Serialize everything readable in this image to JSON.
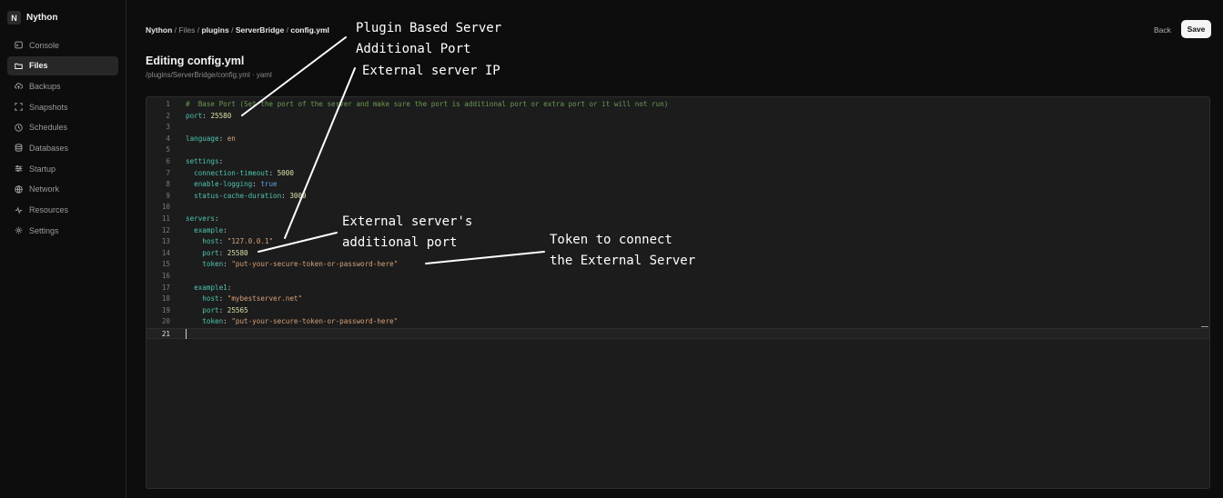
{
  "brand": {
    "initial": "N",
    "name": "Nython"
  },
  "nav": [
    {
      "label": "Console",
      "icon": "console-icon",
      "active": false
    },
    {
      "label": "Files",
      "icon": "folder-icon",
      "active": true
    },
    {
      "label": "Backups",
      "icon": "cloud-upload-icon",
      "active": false
    },
    {
      "label": "Snapshots",
      "icon": "expand-icon",
      "active": false
    },
    {
      "label": "Schedules",
      "icon": "clock-icon",
      "active": false
    },
    {
      "label": "Databases",
      "icon": "database-icon",
      "active": false
    },
    {
      "label": "Startup",
      "icon": "sliders-icon",
      "active": false
    },
    {
      "label": "Network",
      "icon": "globe-icon",
      "active": false
    },
    {
      "label": "Resources",
      "icon": "activity-icon",
      "active": false
    },
    {
      "label": "Settings",
      "icon": "gear-icon",
      "active": false
    }
  ],
  "breadcrumb": {
    "root": "Nython",
    "sep": "/",
    "parts": [
      "Files",
      "plugins",
      "ServerBridge"
    ],
    "current": "config.yml"
  },
  "header": {
    "title": "Editing config.yml",
    "path": "/plugins/ServerBridge/config.yml · yaml",
    "back_label": "Back",
    "save_label": "Save"
  },
  "editor": {
    "current_line": 21,
    "lines": [
      {
        "n": "1",
        "t": [
          [
            "c",
            "#  Base Port (Set the port of the server and make sure the port is additional port or extra port or it will not run)"
          ]
        ]
      },
      {
        "n": "2",
        "t": [
          [
            "k",
            "port"
          ],
          [
            "p",
            ": "
          ],
          [
            "n",
            "25580"
          ]
        ]
      },
      {
        "n": "3",
        "t": []
      },
      {
        "n": "4",
        "t": [
          [
            "k",
            "language"
          ],
          [
            "p",
            ": "
          ],
          [
            "s",
            "en"
          ]
        ]
      },
      {
        "n": "5",
        "t": []
      },
      {
        "n": "6",
        "t": [
          [
            "k",
            "settings"
          ],
          [
            "p",
            ":"
          ]
        ]
      },
      {
        "n": "7",
        "t": [
          [
            "p",
            "  "
          ],
          [
            "k",
            "connection-timeout"
          ],
          [
            "p",
            ": "
          ],
          [
            "n",
            "5000"
          ]
        ]
      },
      {
        "n": "8",
        "t": [
          [
            "p",
            "  "
          ],
          [
            "k",
            "enable-logging"
          ],
          [
            "p",
            ": "
          ],
          [
            "b",
            "true"
          ]
        ]
      },
      {
        "n": "9",
        "t": [
          [
            "p",
            "  "
          ],
          [
            "k",
            "status-cache-duration"
          ],
          [
            "p",
            ": "
          ],
          [
            "n",
            "3000"
          ]
        ]
      },
      {
        "n": "10",
        "t": []
      },
      {
        "n": "11",
        "t": [
          [
            "k",
            "servers"
          ],
          [
            "p",
            ":"
          ]
        ]
      },
      {
        "n": "12",
        "t": [
          [
            "p",
            "  "
          ],
          [
            "k",
            "example"
          ],
          [
            "p",
            ":"
          ]
        ]
      },
      {
        "n": "13",
        "t": [
          [
            "p",
            "    "
          ],
          [
            "k",
            "host"
          ],
          [
            "p",
            ": "
          ],
          [
            "s",
            "\"127.0.0.1\""
          ]
        ]
      },
      {
        "n": "14",
        "t": [
          [
            "p",
            "    "
          ],
          [
            "k",
            "port"
          ],
          [
            "p",
            ": "
          ],
          [
            "n",
            "25580"
          ]
        ]
      },
      {
        "n": "15",
        "t": [
          [
            "p",
            "    "
          ],
          [
            "k",
            "token"
          ],
          [
            "p",
            ": "
          ],
          [
            "s",
            "\"put-your-secure-token-or-password-here\""
          ]
        ]
      },
      {
        "n": "16",
        "t": []
      },
      {
        "n": "17",
        "t": [
          [
            "p",
            "  "
          ],
          [
            "k",
            "example1"
          ],
          [
            "p",
            ":"
          ]
        ]
      },
      {
        "n": "18",
        "t": [
          [
            "p",
            "    "
          ],
          [
            "k",
            "host"
          ],
          [
            "p",
            ": "
          ],
          [
            "s",
            "\"mybestserver.net\""
          ]
        ]
      },
      {
        "n": "19",
        "t": [
          [
            "p",
            "    "
          ],
          [
            "k",
            "port"
          ],
          [
            "p",
            ": "
          ],
          [
            "n",
            "25565"
          ]
        ]
      },
      {
        "n": "20",
        "t": [
          [
            "p",
            "    "
          ],
          [
            "k",
            "token"
          ],
          [
            "p",
            ": "
          ],
          [
            "s",
            "\"put-your-secure-token-or-password-here\""
          ]
        ]
      },
      {
        "n": "21",
        "t": []
      }
    ]
  },
  "annotations": {
    "plugin_port": [
      "Plugin Based Server",
      "Additional Port"
    ],
    "external_ip": [
      "External server IP"
    ],
    "external_port": [
      "External server's",
      "additional port"
    ],
    "token": [
      "Token to connect",
      "the External Server"
    ]
  },
  "colors": {
    "accent": "#f5f5f5",
    "yaml_key": "#4fc4b0",
    "yaml_string": "#d7a27a",
    "yaml_number": "#d6e3a8",
    "yaml_bool": "#5f9fe0",
    "yaml_comment": "#6a9955"
  }
}
